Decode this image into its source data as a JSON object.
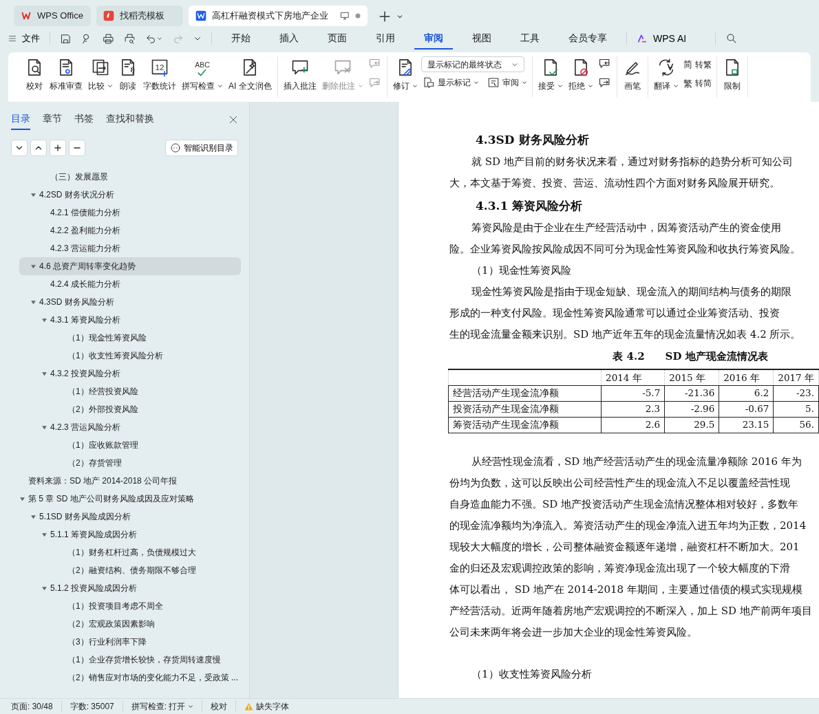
{
  "window_tabs": [
    {
      "label": "WPS Office",
      "selected": false
    },
    {
      "label": "找稻壳模板",
      "selected": false
    },
    {
      "label": "高杠杆融资模式下房地产企业",
      "selected": true
    }
  ],
  "menu": {
    "file": "文件",
    "quick_access": [
      {
        "disabled": false
      },
      {
        "disabled": false
      },
      {
        "disabled": false
      },
      {
        "disabled": false
      },
      {
        "disabled": false
      },
      {
        "disabled": true
      }
    ],
    "tabs": [
      {
        "label": "开始",
        "selected": false
      },
      {
        "label": "插入",
        "selected": false
      },
      {
        "label": "页面",
        "selected": false
      },
      {
        "label": "引用",
        "selected": false
      },
      {
        "label": "审阅",
        "selected": true
      },
      {
        "label": "视图",
        "selected": false
      },
      {
        "label": "工具",
        "selected": false
      },
      {
        "label": "会员专享",
        "selected": false
      }
    ],
    "ai": "WPS AI"
  },
  "ribbon": [
    {
      "items": [
        {
          "kind": "large",
          "label": "校对"
        },
        {
          "kind": "large",
          "label": "标准审查"
        },
        {
          "kind": "large",
          "label": "比较",
          "dropdown": true
        },
        {
          "kind": "large",
          "label": "朗读"
        },
        {
          "kind": "large",
          "label": "字数统计",
          "glyph": "12"
        },
        {
          "kind": "large",
          "label": "拼写检查",
          "dropdown": true,
          "glyph": "ABC"
        },
        {
          "kind": "large",
          "label": "AI 全文润色"
        }
      ]
    },
    {
      "items": [
        {
          "kind": "large",
          "label": "插入批注"
        },
        {
          "kind": "large",
          "label": "删除批注",
          "dropdown": true,
          "disabled": true
        },
        {
          "kind": "column",
          "items": [
            {
              "kind": "icon",
              "disabled": true
            },
            {
              "kind": "icon",
              "disabled": true
            }
          ]
        }
      ]
    },
    {
      "items": [
        {
          "kind": "large",
          "label": "修订",
          "dropdown": true
        },
        {
          "kind": "column",
          "items": [
            {
              "kind": "select",
              "label": "显示标记的最终状态"
            },
            {
              "kind": "row",
              "items": [
                {
                  "kind": "small",
                  "label": "显示标记",
                  "dropdown": true
                },
                {
                  "kind": "small",
                  "label": "审阅",
                  "dropdown": true
                }
              ]
            }
          ]
        }
      ]
    },
    {
      "items": [
        {
          "kind": "large",
          "label": "接受",
          "dropdown": true
        },
        {
          "kind": "large",
          "label": "拒绝",
          "dropdown": true
        },
        {
          "kind": "column",
          "items": [
            {
              "kind": "icon",
              "disabled": false
            },
            {
              "kind": "icon",
              "disabled": false
            }
          ]
        }
      ]
    },
    {
      "items": [
        {
          "kind": "large",
          "label": "画笔"
        }
      ]
    },
    {
      "items": [
        {
          "kind": "large",
          "label": "翻译",
          "dropdown": true
        },
        {
          "kind": "column",
          "items": [
            {
              "kind": "small",
              "label": "转繁",
              "glyph": "简"
            },
            {
              "kind": "small",
              "label": "转简",
              "glyph": "繁"
            }
          ]
        }
      ]
    },
    {
      "items": [
        {
          "kind": "large",
          "label": "限制"
        }
      ]
    }
  ],
  "sidebar": {
    "tabs": [
      {
        "label": "目录",
        "selected": true
      },
      {
        "label": "章节",
        "selected": false
      },
      {
        "label": "书签",
        "selected": false
      },
      {
        "label": "查找和替换",
        "selected": false
      }
    ],
    "smart_button": "智能识别目录",
    "toc": [
      {
        "children": [
          {
            "children": [
              {
                "label": "（三）发展愿景"
              }
            ]
          },
          {
            "label": "4.2SD 财务状况分析",
            "expanded": true,
            "selected": false,
            "children": [
              {
                "label": "4.2.1 偿债能力分析",
                "selected": false
              },
              {
                "label": "4.2.2 盈利能力分析",
                "selected": false
              },
              {
                "label": "4.2.3 营运能力分析",
                "selected": false
              }
            ]
          },
          {
            "label": "4.6 总资产周转率变化趋势",
            "expanded": true,
            "selected": true,
            "children": [
              {
                "label": "4.2.4 成长能力分析",
                "selected": false
              }
            ]
          },
          {
            "label": "4.3SD 财务风险分析",
            "expanded": true,
            "selected": false,
            "children": [
              {
                "label": "4.3.1 筹资风险分析",
                "expanded": true,
                "selected": false,
                "children": [
                  {
                    "label": "（1）现金性筹资风险",
                    "selected": false
                  },
                  {
                    "label": "（1）收支性筹资风险分析",
                    "selected": false
                  }
                ]
              },
              {
                "label": "4.3.2 投资风险分析",
                "expanded": true,
                "selected": false,
                "children": [
                  {
                    "label": "（1）经营投资风险",
                    "selected": false
                  },
                  {
                    "label": "（2）外部投资风险",
                    "selected": false
                  }
                ]
              },
              {
                "label": "4.2.3 营运风险分析",
                "expanded": true,
                "selected": false,
                "children": [
                  {
                    "label": "（1）应收账款管理",
                    "selected": false
                  },
                  {
                    "label": "（2）存货管理",
                    "selected": false
                  }
                ]
              }
            ]
          }
        ]
      },
      {
        "label": "资料来源：SD 地产  2014-2018 公司年报",
        "selected": false
      },
      {
        "label": "第 5 章 SD 地产公司财务风险成因及应对策略",
        "expanded": true,
        "selected": false,
        "children": [
          {
            "label": "5.1SD 财务风险成因分析",
            "expanded": true,
            "selected": false,
            "children": [
              {
                "label": "5.1.1 筹资风险成因分析",
                "expanded": true,
                "selected": false,
                "children": [
                  {
                    "label": "（1）财务杠杆过高，负债规模过大",
                    "selected": false
                  },
                  {
                    "label": "（2）融资结构、债务期限不够合理",
                    "selected": false
                  }
                ]
              },
              {
                "label": "5.1.2 投资风险成因分析",
                "expanded": true,
                "selected": false,
                "children": [
                  {
                    "label": "（1）投资项目考虑不周全",
                    "selected": false
                  },
                  {
                    "label": "（2）宏观政策因素影响",
                    "selected": false
                  },
                  {
                    "label": "（3）行业利润率下降",
                    "selected": false
                  },
                  {
                    "label": "（1）企业存货增长较快，存货周转速度慢",
                    "selected": false
                  },
                  {
                    "label": "（2）销售应对市场的变化能力不足，受政策 ...",
                    "selected": false
                  }
                ]
              }
            ]
          }
        ]
      }
    ]
  },
  "document": [
    {
      "kind": "heading",
      "text": "4.3SD 财务风险分析"
    },
    {
      "kind": "para",
      "lines": [
        "就 SD 地产目前的财务状况来看，通过对财务指标的趋势分析可知公司",
        "大，本文基于筹资、投资、营运、流动性四个方面对财务风险展开研究。"
      ]
    },
    {
      "kind": "heading",
      "text": "4.3.1 筹资风险分析"
    },
    {
      "kind": "para",
      "lines": [
        "筹资风险是由于企业在生产经营活动中，因筹资活动产生的资金使用",
        "险。企业筹资风险按风险成因不同可分为现金性筹资风险和收执行筹资风险。"
      ]
    },
    {
      "kind": "para",
      "lines": [
        "（1）现金性筹资风险"
      ]
    },
    {
      "kind": "para",
      "lines": [
        "现金性筹资风险是指由于现金短缺、现金流入的期间结构与债务的期限",
        "形成的一种支付风险。现金性筹资风险通常可以通过企业筹资活动、投资",
        "生的现金流量金额来识别。SD 地产近年五年的现金流量情况如表  4.2 所示。"
      ]
    },
    {
      "kind": "caption",
      "text": "表 4.2　　SD 地产现金流情况表"
    },
    {
      "kind": "table",
      "columns": [
        "",
        "2014 年",
        "2015 年",
        "2016 年",
        "2017 年"
      ],
      "rows": [
        [
          "经营活动产生现金流净额",
          "-5.7",
          "-21.36",
          "6.2",
          "-23."
        ],
        [
          "投资活动产生现金流净额",
          "2.3",
          "-2.96",
          "-0.67",
          "5."
        ],
        [
          "筹资活动产生现金流净额",
          "2.6",
          "29.5",
          "23.15",
          "56."
        ]
      ]
    },
    {
      "kind": "para",
      "lines": [
        "从经营性现金流看，SD 地产经营活动产生的现金流量净额除 2016 年为",
        "份均为负数，这可以反映出公司经营性产生的现金流入不足以覆盖经营性现",
        "自身造血能力不强。SD 地产投资活动产生现金流情况整体相对较好，多数年",
        "的现金流净额均为净流入。筹资活动产生的现金净流入进五年均为正数，2014",
        "现较大大幅度的增长，公司整体融资金额逐年递增，融资杠杆不断加大。201",
        "金的归还及宏观调控政策的影响，筹资净现金流出现了一个较大幅度的下滑",
        "体可以看出， SD 地产在  2014-2018 年期间，主要通过借债的模式实现规模",
        "产经营活动。近两年随着房地产宏观调控的不断深入，加上 SD 地产前两年项目",
        "公司未来两年将会进一步加大企业的现金性筹资风险。"
      ]
    },
    {
      "kind": "para",
      "lines": [
        "（1）收支性筹资风险分析"
      ],
      "space_before": true
    }
  ],
  "status_bar": [
    {
      "kind": "text",
      "label": "页面: 30/48"
    },
    {
      "kind": "text",
      "label": "字数: 35007"
    },
    {
      "kind": "text",
      "label": "拼写检查: 打开",
      "dropdown": true
    },
    {
      "kind": "text",
      "label": "校对"
    },
    {
      "kind": "warning",
      "label": "缺失字体"
    }
  ]
}
